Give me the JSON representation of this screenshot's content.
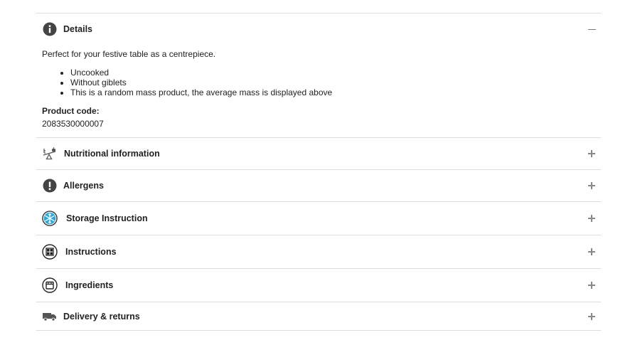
{
  "details": {
    "title": "Details",
    "icon": "info-icon",
    "description": "Perfect for your festive table as a centrepiece.",
    "bullets": [
      "Uncooked",
      "Without giblets",
      "This is a random mass product, the average mass is displayed above"
    ],
    "product_code_label": "Product code:",
    "product_code_value": "2083530000007"
  },
  "sections": [
    {
      "title": "Nutritional information",
      "icon": "scale-icon"
    },
    {
      "title": "Allergens",
      "icon": "exclamation-icon"
    },
    {
      "title": "Storage Instruction",
      "icon": "snowflake-icon"
    },
    {
      "title": "Instructions",
      "icon": "grid-icon"
    },
    {
      "title": "Ingredients",
      "icon": "container-icon"
    },
    {
      "title": "Delivery & returns",
      "icon": "truck-icon"
    }
  ],
  "colors": {
    "icon_dark": "#444444",
    "snowflake_blue": "#29a8df",
    "divider": "#dddddd",
    "toggle": "#888888"
  }
}
